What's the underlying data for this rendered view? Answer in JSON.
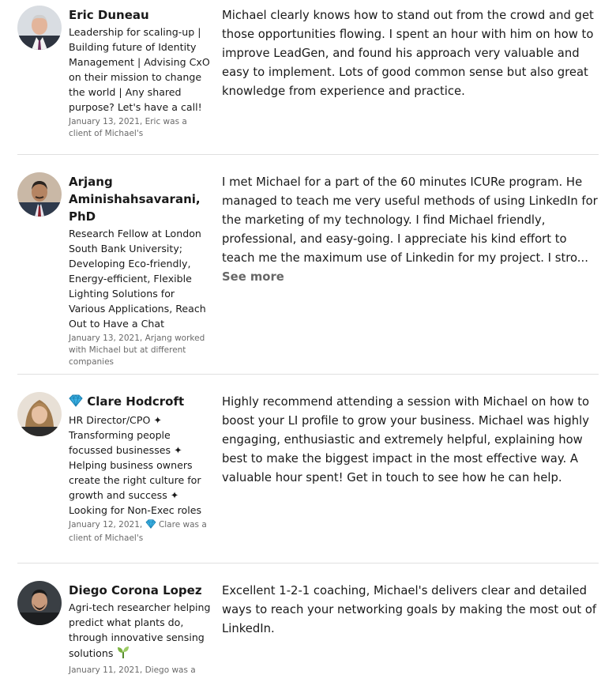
{
  "recommendations": [
    {
      "name": "Eric Duneau",
      "headline": "Leadership for scaling-up | Building future of Identity Management | Advising CxO on their mission to change the world | Any shared purpose? Let's have a call!",
      "date": "January 13, 2021, Eric was a client of Michael's",
      "text": "Michael clearly knows how to stand out from the crowd and get those opportunities flowing. I spent an hour with him on how to improve LeadGen, and found his approach very valuable and easy to implement. Lots of good common sense but also great knowledge from experience and practice.",
      "see_more": ""
    },
    {
      "name": "Arjang Aminishahsavarani, PhD",
      "headline": "Research Fellow at London South Bank University; Developing Eco-friendly, Energy-efficient, Flexible Lighting Solutions for Various Applications, Reach Out to Have a Chat",
      "date": "January 13, 2021, Arjang worked with Michael but at different companies",
      "text": "I met Michael for a part of the 60 minutes ICURe program. He managed to teach me very useful methods of using LinkedIn for the marketing of my technology. I find Michael friendly, professional, and easy-going. I appreciate his kind effort to teach me the maximum use of Linkedin for my project. I stro...",
      "see_more": "See more"
    },
    {
      "name": "Clare Hodcroft",
      "headline": "HR Director/CPO ✦ Transforming people focussed businesses ✦ Helping business owners create the right culture for growth and success ✦ Looking for Non-Exec roles",
      "date_prefix": "January 12, 2021,",
      "date": "Clare was a client of Michael's",
      "text": "Highly recommend attending a session with Michael on how to boost your LI profile to grow your business. Michael was highly engaging, enthusiastic and extremely helpful, explaining how best to make the biggest impact in the most effective way. A valuable hour spent! Get in touch to see how he can help.",
      "see_more": ""
    },
    {
      "name": "Diego Corona Lopez",
      "headline": "Agri-tech researcher helping predict what plants do, through innovative sensing solutions",
      "date": "January 11, 2021, Diego was a",
      "text": "Excellent 1-2-1 coaching, Michael's delivers clear and detailed ways to reach your networking goals by making the most out of LinkedIn.",
      "see_more": ""
    }
  ],
  "icons": {
    "gem": "gem-icon",
    "sprout": "seedling-icon"
  },
  "colors": {
    "divider": "#e0e0e0",
    "secondary_text": "#00000099",
    "gem": "#3ab0e2",
    "sprout": "#7cb342"
  }
}
